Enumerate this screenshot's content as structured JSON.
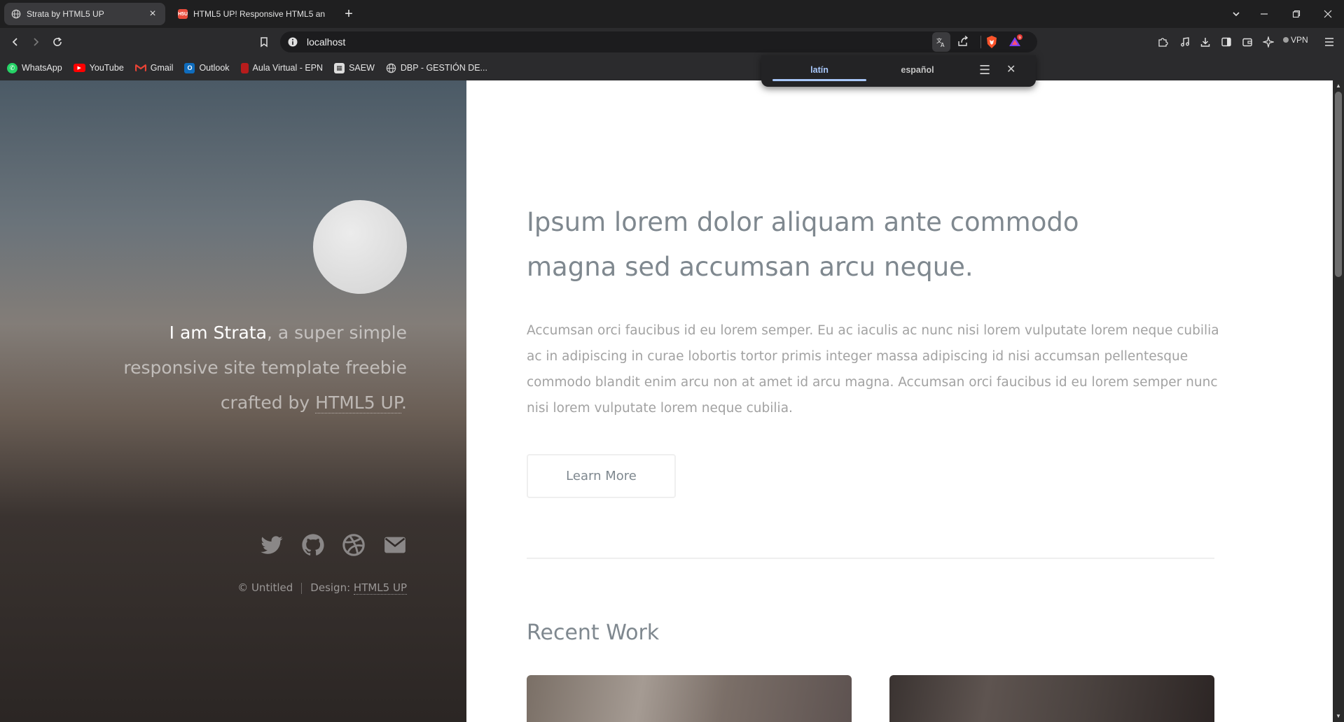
{
  "tabs": [
    {
      "title": "Strata by HTML5 UP",
      "active": true,
      "icon": "globe-icon"
    },
    {
      "title": "HTML5 UP! Responsive HTML5 and",
      "active": false,
      "icon": "html5up-icon",
      "favicon_text": "H5U"
    }
  ],
  "toolbar": {
    "url": "localhost",
    "vpn_label": "VPN"
  },
  "bookmarks": [
    {
      "label": "WhatsApp",
      "icon": "whatsapp-icon",
      "color": "#25d366"
    },
    {
      "label": "YouTube",
      "icon": "youtube-icon",
      "color": "#ff0000"
    },
    {
      "label": "Gmail",
      "icon": "gmail-icon",
      "color": "#ea4335"
    },
    {
      "label": "Outlook",
      "icon": "outlook-icon",
      "color": "#0f6cbd"
    },
    {
      "label": "Aula Virtual - EPN",
      "icon": "epn-icon",
      "color": "#b71c1c"
    },
    {
      "label": "SAEW",
      "icon": "saew-icon",
      "color": "#dddddd"
    },
    {
      "label": "DBP - GESTIÓN DE...",
      "icon": "globe-icon",
      "color": "#cccccc"
    }
  ],
  "translate": {
    "source_lang": "latín",
    "target_lang": "español"
  },
  "sidebar": {
    "intro_strong": "I am Strata",
    "intro_rest": ", a super simple responsive site template freebie crafted by ",
    "intro_link": "HTML5 UP",
    "intro_end": ".",
    "socials": [
      "twitter-icon",
      "github-icon",
      "dribbble-icon",
      "email-icon"
    ],
    "copyright": "© Untitled",
    "design_label": "Design: ",
    "design_link": "HTML5 UP"
  },
  "main": {
    "headline": "Ipsum lorem dolor aliquam ante commodo magna sed accumsan arcu neque.",
    "paragraph": "Accumsan orci faucibus id eu lorem semper. Eu ac iaculis ac nunc nisi lorem vulputate lorem neque cubilia ac in adipiscing in curae lobortis tortor primis integer massa adipiscing id nisi accumsan pellentesque commodo blandit enim arcu non at amet id arcu magna. Accumsan orci faucibus id eu lorem semper nunc nisi lorem vulputate lorem neque cubilia.",
    "learn_more": "Learn More",
    "recent_work_title": "Recent Work"
  }
}
